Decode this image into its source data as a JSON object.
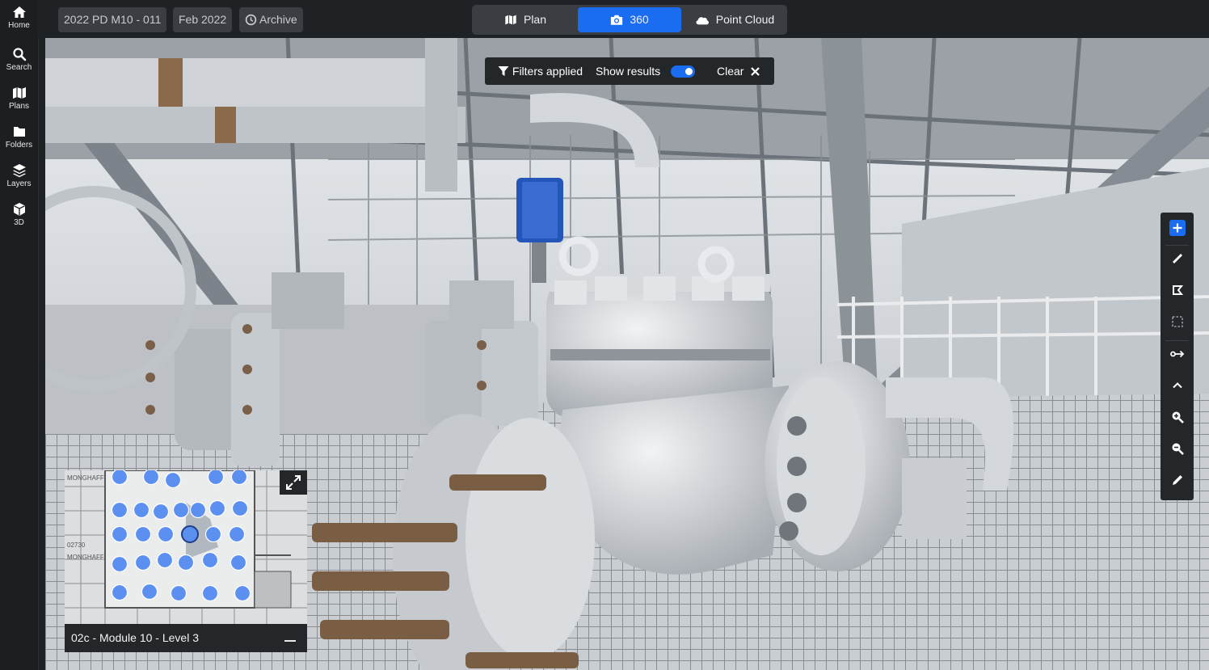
{
  "sidebar": {
    "items": [
      {
        "label": "Home",
        "icon": "home-icon"
      },
      {
        "label": "Search",
        "icon": "search-icon"
      },
      {
        "label": "Plans",
        "icon": "map-icon"
      },
      {
        "label": "Folders",
        "icon": "folder-icon"
      },
      {
        "label": "Layers",
        "icon": "layers-icon"
      },
      {
        "label": "3D",
        "icon": "cube-icon"
      }
    ]
  },
  "topbar": {
    "project": "2022 PD M10 - 011",
    "date": "Feb 2022",
    "archive_label": "Archive",
    "view_modes": [
      {
        "label": "Plan",
        "icon": "map-icon",
        "active": false
      },
      {
        "label": "360",
        "icon": "camera-icon",
        "active": true
      },
      {
        "label": "Point Cloud",
        "icon": "cloud-icon",
        "active": false
      }
    ]
  },
  "filters": {
    "status_label": "Filters applied",
    "toggle_label": "Show results",
    "toggle_on": true,
    "clear_label": "Clear"
  },
  "tools": [
    {
      "name": "add-icon",
      "active": true
    },
    {
      "name": "ruler-icon"
    },
    {
      "name": "area-measure-icon"
    },
    {
      "name": "select-box-icon"
    },
    {
      "name": "route-icon"
    },
    {
      "name": "chevron-up-icon"
    },
    {
      "name": "zoom-in-icon"
    },
    {
      "name": "zoom-out-icon"
    },
    {
      "name": "pencil-icon"
    }
  ],
  "minimap": {
    "caption": "02c - Module 10 - Level 3",
    "labels": [
      "MONGHAFF",
      "02730",
      "MONGHAFF"
    ]
  },
  "colors": {
    "accent": "#1a6cf0",
    "panel": "#24272a",
    "chip": "#3a3e43",
    "marker": "#5b8ff0"
  }
}
